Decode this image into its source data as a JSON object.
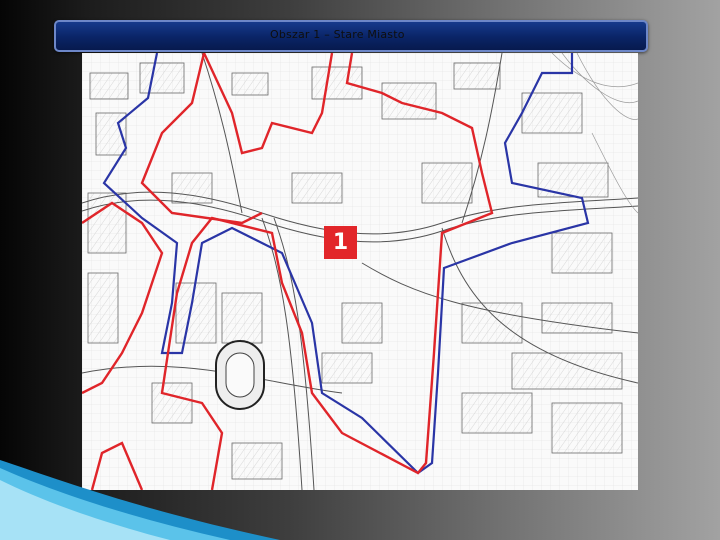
{
  "slide": {
    "title": "Obszar 1 – Stare Miasto"
  },
  "map": {
    "area_label": "1",
    "colors": {
      "planned_boundary": "#e0252a",
      "outer_boundary": "#2a35a6",
      "background": "#fafafa"
    }
  }
}
